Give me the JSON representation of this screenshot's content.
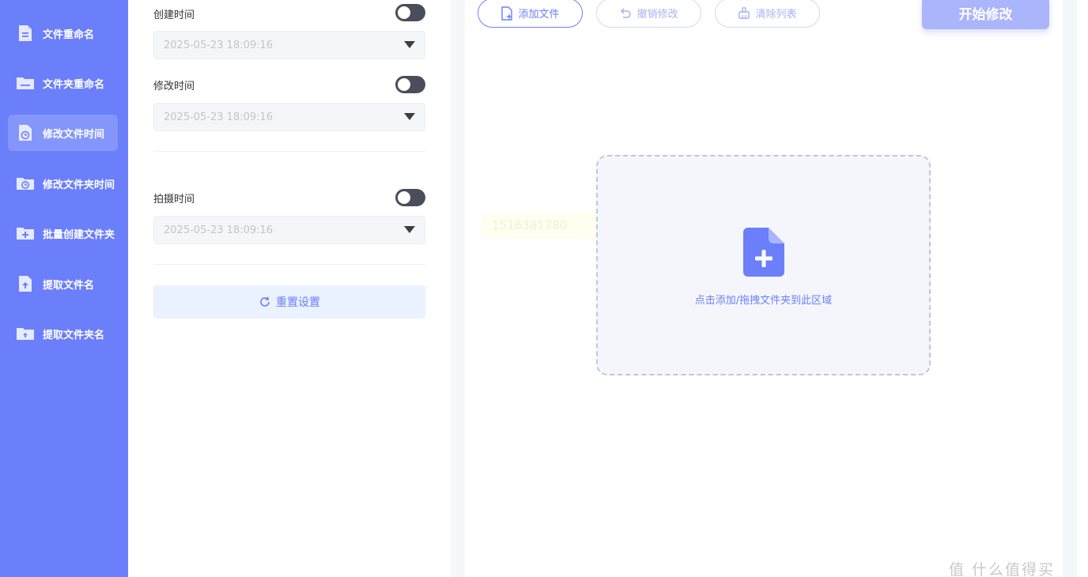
{
  "sidebar": {
    "items": [
      {
        "label": "文件重命名",
        "icon": "document-icon",
        "active": false
      },
      {
        "label": "文件夹重命名",
        "icon": "folder-icon",
        "active": false
      },
      {
        "label": "修改文件时间",
        "icon": "document-clock-icon",
        "active": true
      },
      {
        "label": "修改文件夹时间",
        "icon": "folder-clock-icon",
        "active": false
      },
      {
        "label": "批量创建文件夹",
        "icon": "folder-plus-icon",
        "active": false
      },
      {
        "label": "提取文件名",
        "icon": "document-upload-icon",
        "active": false
      },
      {
        "label": "提取文件夹名",
        "icon": "folder-upload-icon",
        "active": false
      }
    ]
  },
  "settings": {
    "created": {
      "label": "创建时间",
      "value": "2025-05-23 18:09:16",
      "enabled": false
    },
    "modified": {
      "label": "修改时间",
      "value": "2025-05-23 18:09:16",
      "enabled": false
    },
    "taken": {
      "label": "拍摄时间",
      "value": "2025-05-23 18:09:16",
      "enabled": false
    },
    "reset_label": "重置设置"
  },
  "toolbar": {
    "add_label": "添加文件",
    "undo_label": "撤销修改",
    "clear_label": "清除列表",
    "start_label": "开始修改"
  },
  "main": {
    "ghost_text": "1516381780",
    "drop_text": "点击添加/拖拽文件夹到此区域"
  },
  "watermark": "值 什么值得买",
  "colors": {
    "accent": "#6b7ffb",
    "sidebar_bg": "#6b7ffb",
    "start_button": "#aab5fb",
    "toggle_off": "#4a4e5a"
  }
}
